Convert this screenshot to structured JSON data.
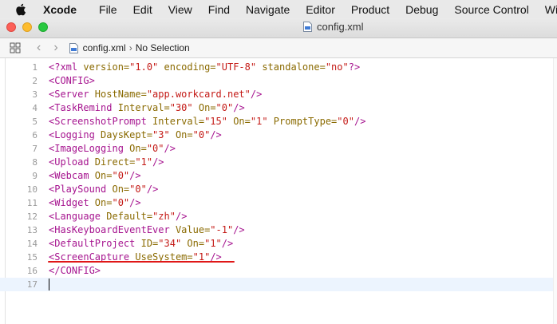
{
  "menubar": {
    "app": "Xcode",
    "items": [
      "File",
      "Edit",
      "View",
      "Find",
      "Navigate",
      "Editor",
      "Product",
      "Debug",
      "Source Control",
      "Win"
    ]
  },
  "window": {
    "title": "config.xml"
  },
  "jumpbar": {
    "file": "config.xml",
    "selection": "No Selection"
  },
  "editor": {
    "lines": [
      {
        "n": "1",
        "parts": [
          [
            "pi",
            "<?xml "
          ],
          [
            "attr",
            "version="
          ],
          [
            "val",
            "\"1.0\""
          ],
          [
            "attr",
            " encoding="
          ],
          [
            "val",
            "\"UTF-8\""
          ],
          [
            "attr",
            " standalone="
          ],
          [
            "val",
            "\"no\""
          ],
          [
            "pi",
            "?>"
          ]
        ]
      },
      {
        "n": "2",
        "parts": [
          [
            "tag",
            "<CONFIG>"
          ]
        ]
      },
      {
        "n": "3",
        "parts": [
          [
            "tag",
            "<Server"
          ],
          [
            "attr",
            " HostName="
          ],
          [
            "val",
            "\"app.workcard.net\""
          ],
          [
            "tag",
            "/>"
          ]
        ]
      },
      {
        "n": "4",
        "parts": [
          [
            "tag",
            "<TaskRemind"
          ],
          [
            "attr",
            " Interval="
          ],
          [
            "val",
            "\"30\""
          ],
          [
            "attr",
            " On="
          ],
          [
            "val",
            "\"0\""
          ],
          [
            "tag",
            "/>"
          ]
        ]
      },
      {
        "n": "5",
        "parts": [
          [
            "tag",
            "<ScreenshotPrompt"
          ],
          [
            "attr",
            " Interval="
          ],
          [
            "val",
            "\"15\""
          ],
          [
            "attr",
            " On="
          ],
          [
            "val",
            "\"1\""
          ],
          [
            "attr",
            " PromptType="
          ],
          [
            "val",
            "\"0\""
          ],
          [
            "tag",
            "/>"
          ]
        ]
      },
      {
        "n": "6",
        "parts": [
          [
            "tag",
            "<Logging"
          ],
          [
            "attr",
            " DaysKept="
          ],
          [
            "val",
            "\"3\""
          ],
          [
            "attr",
            " On="
          ],
          [
            "val",
            "\"0\""
          ],
          [
            "tag",
            "/>"
          ]
        ]
      },
      {
        "n": "7",
        "parts": [
          [
            "tag",
            "<ImageLogging"
          ],
          [
            "attr",
            " On="
          ],
          [
            "val",
            "\"0\""
          ],
          [
            "tag",
            "/>"
          ]
        ]
      },
      {
        "n": "8",
        "parts": [
          [
            "tag",
            "<Upload"
          ],
          [
            "attr",
            " Direct="
          ],
          [
            "val",
            "\"1\""
          ],
          [
            "tag",
            "/>"
          ]
        ]
      },
      {
        "n": "9",
        "parts": [
          [
            "tag",
            "<Webcam"
          ],
          [
            "attr",
            " On="
          ],
          [
            "val",
            "\"0\""
          ],
          [
            "tag",
            "/>"
          ]
        ]
      },
      {
        "n": "10",
        "parts": [
          [
            "tag",
            "<PlaySound"
          ],
          [
            "attr",
            " On="
          ],
          [
            "val",
            "\"0\""
          ],
          [
            "tag",
            "/>"
          ]
        ]
      },
      {
        "n": "11",
        "parts": [
          [
            "tag",
            "<Widget"
          ],
          [
            "attr",
            " On="
          ],
          [
            "val",
            "\"0\""
          ],
          [
            "tag",
            "/>"
          ]
        ]
      },
      {
        "n": "12",
        "parts": [
          [
            "tag",
            "<Language"
          ],
          [
            "attr",
            " Default="
          ],
          [
            "val",
            "\"zh\""
          ],
          [
            "tag",
            "/>"
          ]
        ]
      },
      {
        "n": "13",
        "parts": [
          [
            "tag",
            "<HasKeyboardEventEver"
          ],
          [
            "attr",
            " Value="
          ],
          [
            "val",
            "\"-1\""
          ],
          [
            "tag",
            "/>"
          ]
        ]
      },
      {
        "n": "14",
        "parts": [
          [
            "tag",
            "<DefaultProject"
          ],
          [
            "attr",
            " ID="
          ],
          [
            "val",
            "\"34\""
          ],
          [
            "attr",
            " On="
          ],
          [
            "val",
            "\"1\""
          ],
          [
            "tag",
            "/>"
          ]
        ]
      },
      {
        "n": "15",
        "parts": [
          [
            "tag",
            "<ScreenCapture"
          ],
          [
            "attr",
            " UseSystem="
          ],
          [
            "val",
            "\"1\""
          ],
          [
            "tag",
            "/>"
          ]
        ]
      },
      {
        "n": "16",
        "parts": [
          [
            "tag",
            "</CONFIG>"
          ]
        ]
      },
      {
        "n": "17",
        "parts": []
      }
    ]
  },
  "colors": {
    "tag": "#a6148f",
    "attribute": "#8a6a00",
    "value": "#c41a16",
    "highlight_underline": "#e01717"
  }
}
